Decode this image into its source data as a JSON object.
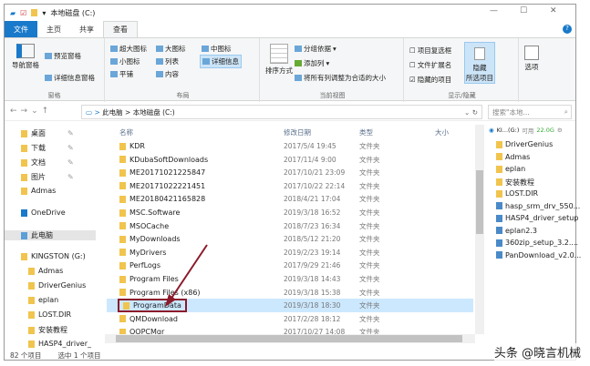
{
  "window": {
    "title": "本地磁盘 (C:)",
    "min": "—",
    "max": "☐",
    "close": "✕"
  },
  "tabs": [
    "文件",
    "主页",
    "共享",
    "查看"
  ],
  "ribbon": {
    "panes": {
      "nav": "导航窗格",
      "preview": "预览窗格",
      "details": "详细信息窗格",
      "label": "窗格"
    },
    "layout": {
      "items": [
        "超大图标",
        "大图标",
        "中图标",
        "小图标",
        "列表",
        "详细信息",
        "平铺",
        "内容"
      ],
      "label": "布局"
    },
    "view": {
      "sort": "排序方式",
      "group": "分组依据",
      "addcol": "添加列",
      "fit": "将所有列调整为合适的大小",
      "label": "当前视图"
    },
    "show": {
      "checkboxes": "项目复选框",
      "ext": "文件扩展名",
      "hidden": "隐藏的项目",
      "hide_sel": "隐藏",
      "hide_sel2": "所选项目",
      "options": "选项",
      "label": "显示/隐藏"
    }
  },
  "address": {
    "path": [
      "此电脑",
      "本地磁盘 (C:)"
    ],
    "search_placeholder": "搜索\"本地...",
    "sep": ">"
  },
  "sidebar": [
    "桌面",
    "下载",
    "文档",
    "图片",
    "Admas",
    "OneDrive",
    "此电脑",
    "KINGSTON (G:)",
    "Admas",
    "DriverGenius",
    "eplan",
    "LOST.DIR",
    "安装教程",
    "HASP4_driver_"
  ],
  "columns": [
    "名称",
    "修改日期",
    "类型",
    "大小"
  ],
  "files": [
    {
      "name": "KDR",
      "date": "2017/5/4 19:45",
      "type": "文件夹"
    },
    {
      "name": "KDubaSoftDownloads",
      "date": "2017/11/4 9:00",
      "type": "文件夹"
    },
    {
      "name": "ME20171021225847",
      "date": "2017/10/21 23:09",
      "type": "文件夹"
    },
    {
      "name": "ME20171022221451",
      "date": "2017/10/22 22:14",
      "type": "文件夹"
    },
    {
      "name": "ME20180421165828",
      "date": "2018/4/21 17:04",
      "type": "文件夹"
    },
    {
      "name": "MSC.Software",
      "date": "2019/3/18 16:52",
      "type": "文件夹"
    },
    {
      "name": "MSOCache",
      "date": "2018/7/23 16:34",
      "type": "文件夹"
    },
    {
      "name": "MyDownloads",
      "date": "2018/5/12 21:20",
      "type": "文件夹"
    },
    {
      "name": "MyDrivers",
      "date": "2019/2/23 19:14",
      "type": "文件夹"
    },
    {
      "name": "PerfLogs",
      "date": "2017/9/29 21:46",
      "type": "文件夹"
    },
    {
      "name": "Program Files",
      "date": "2019/3/18 14:43",
      "type": "文件夹"
    },
    {
      "name": "Program Files (x86)",
      "date": "2019/3/18 15:38",
      "type": "文件夹"
    },
    {
      "name": "ProgramData",
      "date": "2019/3/18 18:30",
      "type": "文件夹"
    },
    {
      "name": "QMDownload",
      "date": "2017/2/28 18:12",
      "type": "文件夹"
    },
    {
      "name": "QQPCMgr",
      "date": "2017/10/27 14:08",
      "type": "文件夹"
    }
  ],
  "status": {
    "count": "82 个项目",
    "selected": "选中 1 个项目"
  },
  "usb_panel": {
    "drive": "KI...(G:)",
    "free_label": "可用",
    "free": "22.0G",
    "items": [
      "DriverGenius",
      "Admas",
      "eplan",
      "安装教程",
      "LOST.DIR",
      "hasp_srm_drv_550...",
      "HASP4_driver_setup",
      "eplan2.3",
      "360zip_setup_3.2....",
      "PanDownload_v2.0..."
    ]
  },
  "watermark": "头条 @晓言机械",
  "colors": {
    "accent": "#1979ca",
    "selection": "#cce8ff",
    "highlight_box": "#8b1a2b"
  }
}
